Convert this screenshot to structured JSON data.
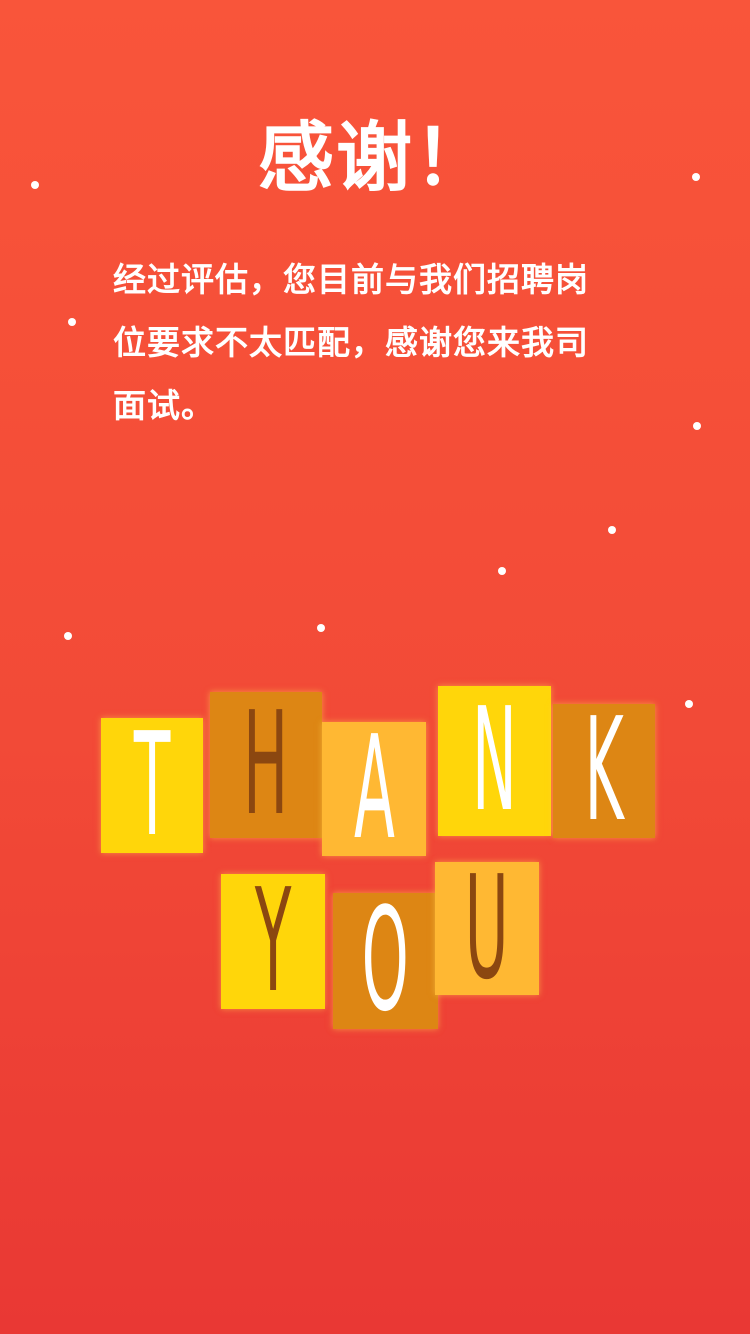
{
  "header": {
    "title": "感谢！"
  },
  "message": {
    "lines": [
      "经过评估，您目前与我们招聘岗",
      "位要求不太匹配，感谢您来我司",
      "面试。"
    ]
  },
  "illustration": {
    "tiles": [
      {
        "letter": "T",
        "color": "yellow",
        "text_color": "white"
      },
      {
        "letter": "H",
        "color": "orange",
        "text_color": "brown"
      },
      {
        "letter": "A",
        "color": "light",
        "text_color": "white"
      },
      {
        "letter": "N",
        "color": "yellow",
        "text_color": "white"
      },
      {
        "letter": "K",
        "color": "orange",
        "text_color": "white"
      },
      {
        "letter": "Y",
        "color": "yellow",
        "text_color": "brown"
      },
      {
        "letter": "O",
        "color": "orange",
        "text_color": "white"
      },
      {
        "letter": "U",
        "color": "light",
        "text_color": "brown"
      }
    ]
  },
  "colors": {
    "background_top": "#f9553a",
    "background_bottom": "#e93834",
    "tile_yellow": "#ffd60a",
    "tile_orange": "#dd8614",
    "tile_light": "#ffb833"
  }
}
